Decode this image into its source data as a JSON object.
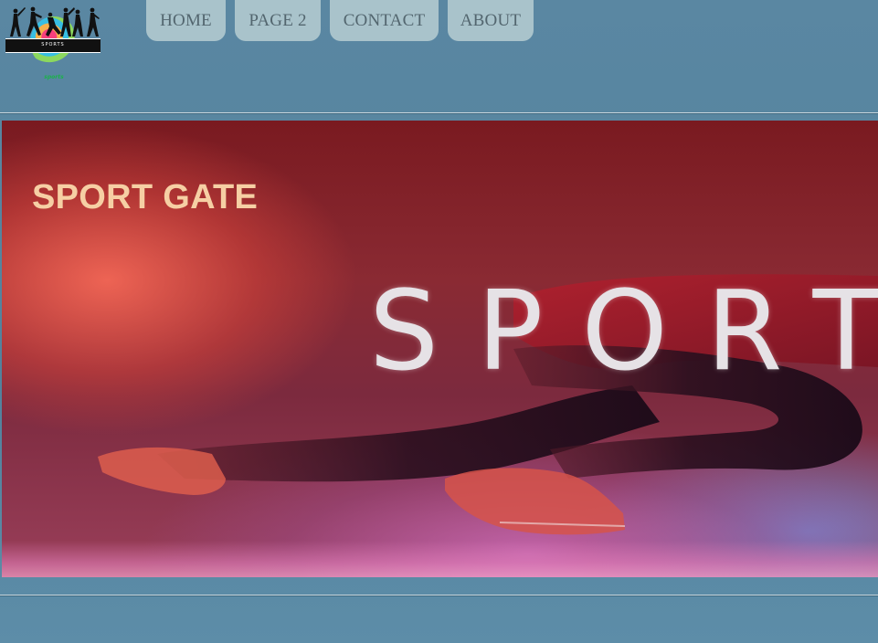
{
  "logo": {
    "band_text": "SPORTS",
    "caption": "sports"
  },
  "nav": {
    "items": [
      {
        "label": "HOME"
      },
      {
        "label": "PAGE 2"
      },
      {
        "label": "CONTACT"
      },
      {
        "label": "ABOUT"
      }
    ]
  },
  "hero": {
    "title": "SPORT GATE",
    "image_text": "SPORT"
  },
  "colors": {
    "page_background": "#5a87a2",
    "nav_button": "#a9c3cb",
    "nav_text": "#53666f",
    "hero_title": "#f6cfa4"
  }
}
